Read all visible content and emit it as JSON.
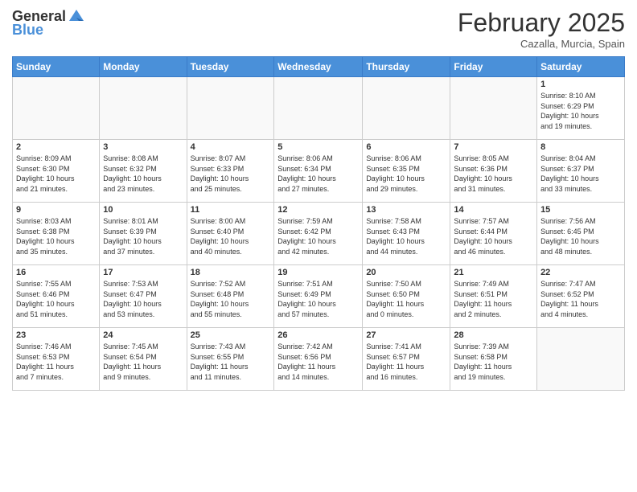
{
  "header": {
    "logo_line1": "General",
    "logo_line2": "Blue",
    "month": "February 2025",
    "location": "Cazalla, Murcia, Spain"
  },
  "weekdays": [
    "Sunday",
    "Monday",
    "Tuesday",
    "Wednesday",
    "Thursday",
    "Friday",
    "Saturday"
  ],
  "weeks": [
    [
      {
        "day": "",
        "info": ""
      },
      {
        "day": "",
        "info": ""
      },
      {
        "day": "",
        "info": ""
      },
      {
        "day": "",
        "info": ""
      },
      {
        "day": "",
        "info": ""
      },
      {
        "day": "",
        "info": ""
      },
      {
        "day": "1",
        "info": "Sunrise: 8:10 AM\nSunset: 6:29 PM\nDaylight: 10 hours\nand 19 minutes."
      }
    ],
    [
      {
        "day": "2",
        "info": "Sunrise: 8:09 AM\nSunset: 6:30 PM\nDaylight: 10 hours\nand 21 minutes."
      },
      {
        "day": "3",
        "info": "Sunrise: 8:08 AM\nSunset: 6:32 PM\nDaylight: 10 hours\nand 23 minutes."
      },
      {
        "day": "4",
        "info": "Sunrise: 8:07 AM\nSunset: 6:33 PM\nDaylight: 10 hours\nand 25 minutes."
      },
      {
        "day": "5",
        "info": "Sunrise: 8:06 AM\nSunset: 6:34 PM\nDaylight: 10 hours\nand 27 minutes."
      },
      {
        "day": "6",
        "info": "Sunrise: 8:06 AM\nSunset: 6:35 PM\nDaylight: 10 hours\nand 29 minutes."
      },
      {
        "day": "7",
        "info": "Sunrise: 8:05 AM\nSunset: 6:36 PM\nDaylight: 10 hours\nand 31 minutes."
      },
      {
        "day": "8",
        "info": "Sunrise: 8:04 AM\nSunset: 6:37 PM\nDaylight: 10 hours\nand 33 minutes."
      }
    ],
    [
      {
        "day": "9",
        "info": "Sunrise: 8:03 AM\nSunset: 6:38 PM\nDaylight: 10 hours\nand 35 minutes."
      },
      {
        "day": "10",
        "info": "Sunrise: 8:01 AM\nSunset: 6:39 PM\nDaylight: 10 hours\nand 37 minutes."
      },
      {
        "day": "11",
        "info": "Sunrise: 8:00 AM\nSunset: 6:40 PM\nDaylight: 10 hours\nand 40 minutes."
      },
      {
        "day": "12",
        "info": "Sunrise: 7:59 AM\nSunset: 6:42 PM\nDaylight: 10 hours\nand 42 minutes."
      },
      {
        "day": "13",
        "info": "Sunrise: 7:58 AM\nSunset: 6:43 PM\nDaylight: 10 hours\nand 44 minutes."
      },
      {
        "day": "14",
        "info": "Sunrise: 7:57 AM\nSunset: 6:44 PM\nDaylight: 10 hours\nand 46 minutes."
      },
      {
        "day": "15",
        "info": "Sunrise: 7:56 AM\nSunset: 6:45 PM\nDaylight: 10 hours\nand 48 minutes."
      }
    ],
    [
      {
        "day": "16",
        "info": "Sunrise: 7:55 AM\nSunset: 6:46 PM\nDaylight: 10 hours\nand 51 minutes."
      },
      {
        "day": "17",
        "info": "Sunrise: 7:53 AM\nSunset: 6:47 PM\nDaylight: 10 hours\nand 53 minutes."
      },
      {
        "day": "18",
        "info": "Sunrise: 7:52 AM\nSunset: 6:48 PM\nDaylight: 10 hours\nand 55 minutes."
      },
      {
        "day": "19",
        "info": "Sunrise: 7:51 AM\nSunset: 6:49 PM\nDaylight: 10 hours\nand 57 minutes."
      },
      {
        "day": "20",
        "info": "Sunrise: 7:50 AM\nSunset: 6:50 PM\nDaylight: 11 hours\nand 0 minutes."
      },
      {
        "day": "21",
        "info": "Sunrise: 7:49 AM\nSunset: 6:51 PM\nDaylight: 11 hours\nand 2 minutes."
      },
      {
        "day": "22",
        "info": "Sunrise: 7:47 AM\nSunset: 6:52 PM\nDaylight: 11 hours\nand 4 minutes."
      }
    ],
    [
      {
        "day": "23",
        "info": "Sunrise: 7:46 AM\nSunset: 6:53 PM\nDaylight: 11 hours\nand 7 minutes."
      },
      {
        "day": "24",
        "info": "Sunrise: 7:45 AM\nSunset: 6:54 PM\nDaylight: 11 hours\nand 9 minutes."
      },
      {
        "day": "25",
        "info": "Sunrise: 7:43 AM\nSunset: 6:55 PM\nDaylight: 11 hours\nand 11 minutes."
      },
      {
        "day": "26",
        "info": "Sunrise: 7:42 AM\nSunset: 6:56 PM\nDaylight: 11 hours\nand 14 minutes."
      },
      {
        "day": "27",
        "info": "Sunrise: 7:41 AM\nSunset: 6:57 PM\nDaylight: 11 hours\nand 16 minutes."
      },
      {
        "day": "28",
        "info": "Sunrise: 7:39 AM\nSunset: 6:58 PM\nDaylight: 11 hours\nand 19 minutes."
      },
      {
        "day": "",
        "info": ""
      }
    ]
  ]
}
